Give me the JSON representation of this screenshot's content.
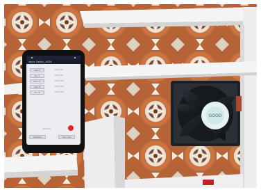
{
  "photo": {
    "subject": "photo-of-smartphone-switch-app-and-cooling-fan"
  },
  "app": {
    "title": "Voice Switch_4024",
    "switches": [
      {
        "label": "Light on",
        "state": "Switch ON"
      },
      {
        "label": "Fan on",
        "state": "Switch ON"
      },
      {
        "label": "Motor on",
        "state": "Switch OFF"
      },
      {
        "label": "Light off",
        "state": "Switch OFF"
      },
      {
        "label": "Fan off",
        "state": "Switch OFF"
      }
    ],
    "status_text": "Not ready",
    "bottom_buttons": [
      "Bluetooth",
      "Voice input"
    ]
  },
  "fan": {
    "label_text": "GOOD"
  },
  "colors": {
    "status_dot": "#e3242b",
    "appbar": "#151a2c"
  }
}
